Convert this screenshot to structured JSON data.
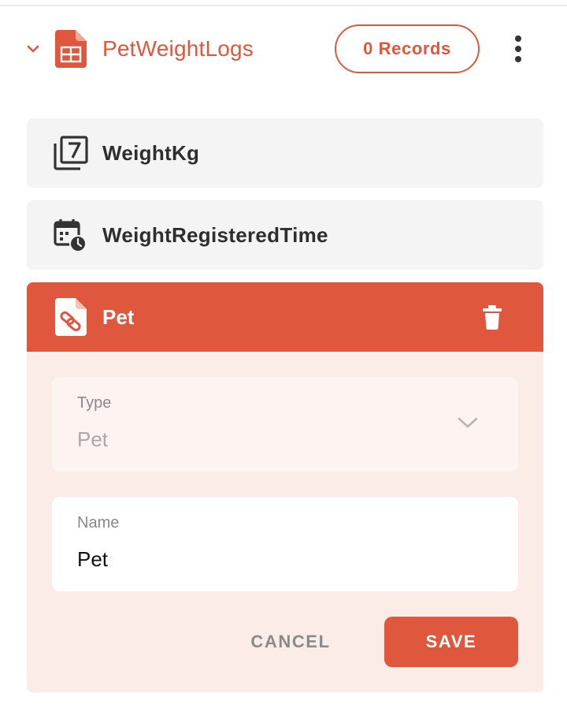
{
  "table": {
    "name": "PetWeightLogs",
    "records_label": "0 Records",
    "icon": "spreadsheet-icon",
    "accent_color": "#df573c"
  },
  "fields": [
    {
      "label": "WeightKg",
      "icon": "number-field-icon"
    },
    {
      "label": "WeightRegisteredTime",
      "icon": "datetime-field-icon"
    }
  ],
  "relationship": {
    "label": "Pet",
    "icon": "linked-record-icon",
    "type_label": "Type",
    "type_value": "Pet",
    "name_label": "Name",
    "name_value": "Pet",
    "cancel_label": "CANCEL",
    "save_label": "SAVE"
  }
}
